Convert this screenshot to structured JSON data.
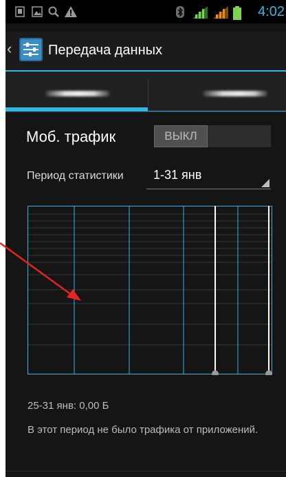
{
  "status_bar": {
    "time": "4:02",
    "left_icons": [
      "sim-icon",
      "image-icon",
      "search-icon",
      "warning-icon"
    ],
    "right_icons": [
      "bluetooth-icon",
      "signal-icon",
      "signal-icon",
      "battery-icon"
    ]
  },
  "action_bar": {
    "back_glyph": "‹",
    "title": "Передача данных"
  },
  "tabs": [
    {
      "label": "",
      "selected": true
    },
    {
      "label": "",
      "selected": false
    }
  ],
  "mobile_traffic": {
    "label": "Моб. трафик",
    "toggle_state": "ВЫКЛ"
  },
  "period": {
    "label": "Период статистики",
    "value": "1-31 янв"
  },
  "usage_chart": {
    "accent_color": "#33b5e5"
  },
  "summary": "25-31 янв: 0,00 Б",
  "note": "В этот период не было трафика от приложений.",
  "annotation": {
    "arrow_color": "#e8231f"
  }
}
